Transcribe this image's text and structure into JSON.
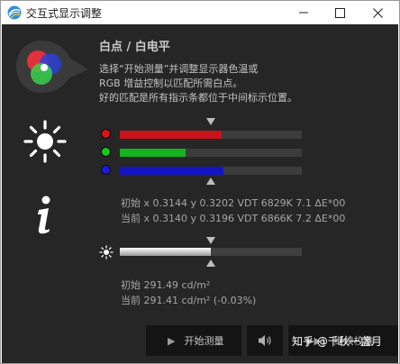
{
  "window": {
    "title": "交互式显示调整",
    "controls": [
      "minimize-icon",
      "maximize-icon",
      "close-icon"
    ]
  },
  "header": {
    "heading": "白点 / 白电平",
    "description": [
      "选择“开始测量”并调整显示器色温或",
      "RGB 增益控制以匹配所需白点。",
      "好的匹配是所有指示条都位于中间标示位置。"
    ]
  },
  "rgb_bars": [
    {
      "channel": "red",
      "color": "#c8141a",
      "fill_fraction": 0.56
    },
    {
      "channel": "green",
      "color": "#15b31f",
      "fill_fraction": 0.36
    },
    {
      "channel": "blue",
      "color": "#1515c6",
      "fill_fraction": 0.57
    }
  ],
  "rgb_target_fraction": 0.5,
  "white_point": {
    "initial": "初始 x 0.3144 y 0.3202 VDT 6829K 7.1 ΔE*00",
    "current": "当前 x 0.3140 y 0.3196 VDT 6866K 7.2 ΔE*00"
  },
  "brightness": {
    "fill_fraction": 0.5,
    "target_fraction": 0.5,
    "initial": "初始 291.49 cd/m²",
    "current": "当前 291.41 cd/m² (-0.03%)"
  },
  "buttons": {
    "start_label": "开始测量",
    "sound_icon": "speaker-icon",
    "continue_label": "继续校准"
  },
  "watermark": "知乎 @千秋一盏月"
}
